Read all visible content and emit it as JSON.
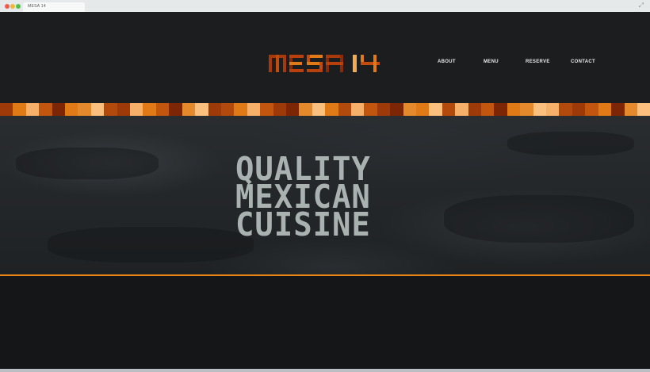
{
  "browser": {
    "tab_label": "MESA 14",
    "expand_icon": "expand-icon"
  },
  "logo": {
    "text": "MESA 14",
    "colors": [
      "#b8400c",
      "#e07a16",
      "#8a2b07",
      "#f7a94e"
    ]
  },
  "nav": {
    "items": [
      {
        "label": "ABOUT"
      },
      {
        "label": "MENU"
      },
      {
        "label": "RESERVE"
      },
      {
        "label": "CONTACT"
      }
    ]
  },
  "hero": {
    "line1": "QUALITY",
    "line2": "MEXICAN",
    "line3": "CUISINE"
  },
  "colors": {
    "background": "#16181a",
    "accent": "#e98517",
    "text_light": "#a9b2b1",
    "strip": [
      "#9e3a0a",
      "#e07a16",
      "#f6b06a",
      "#c2560f",
      "#7d2606",
      "#e58a2c",
      "#fbc07e",
      "#b24a0d"
    ]
  }
}
